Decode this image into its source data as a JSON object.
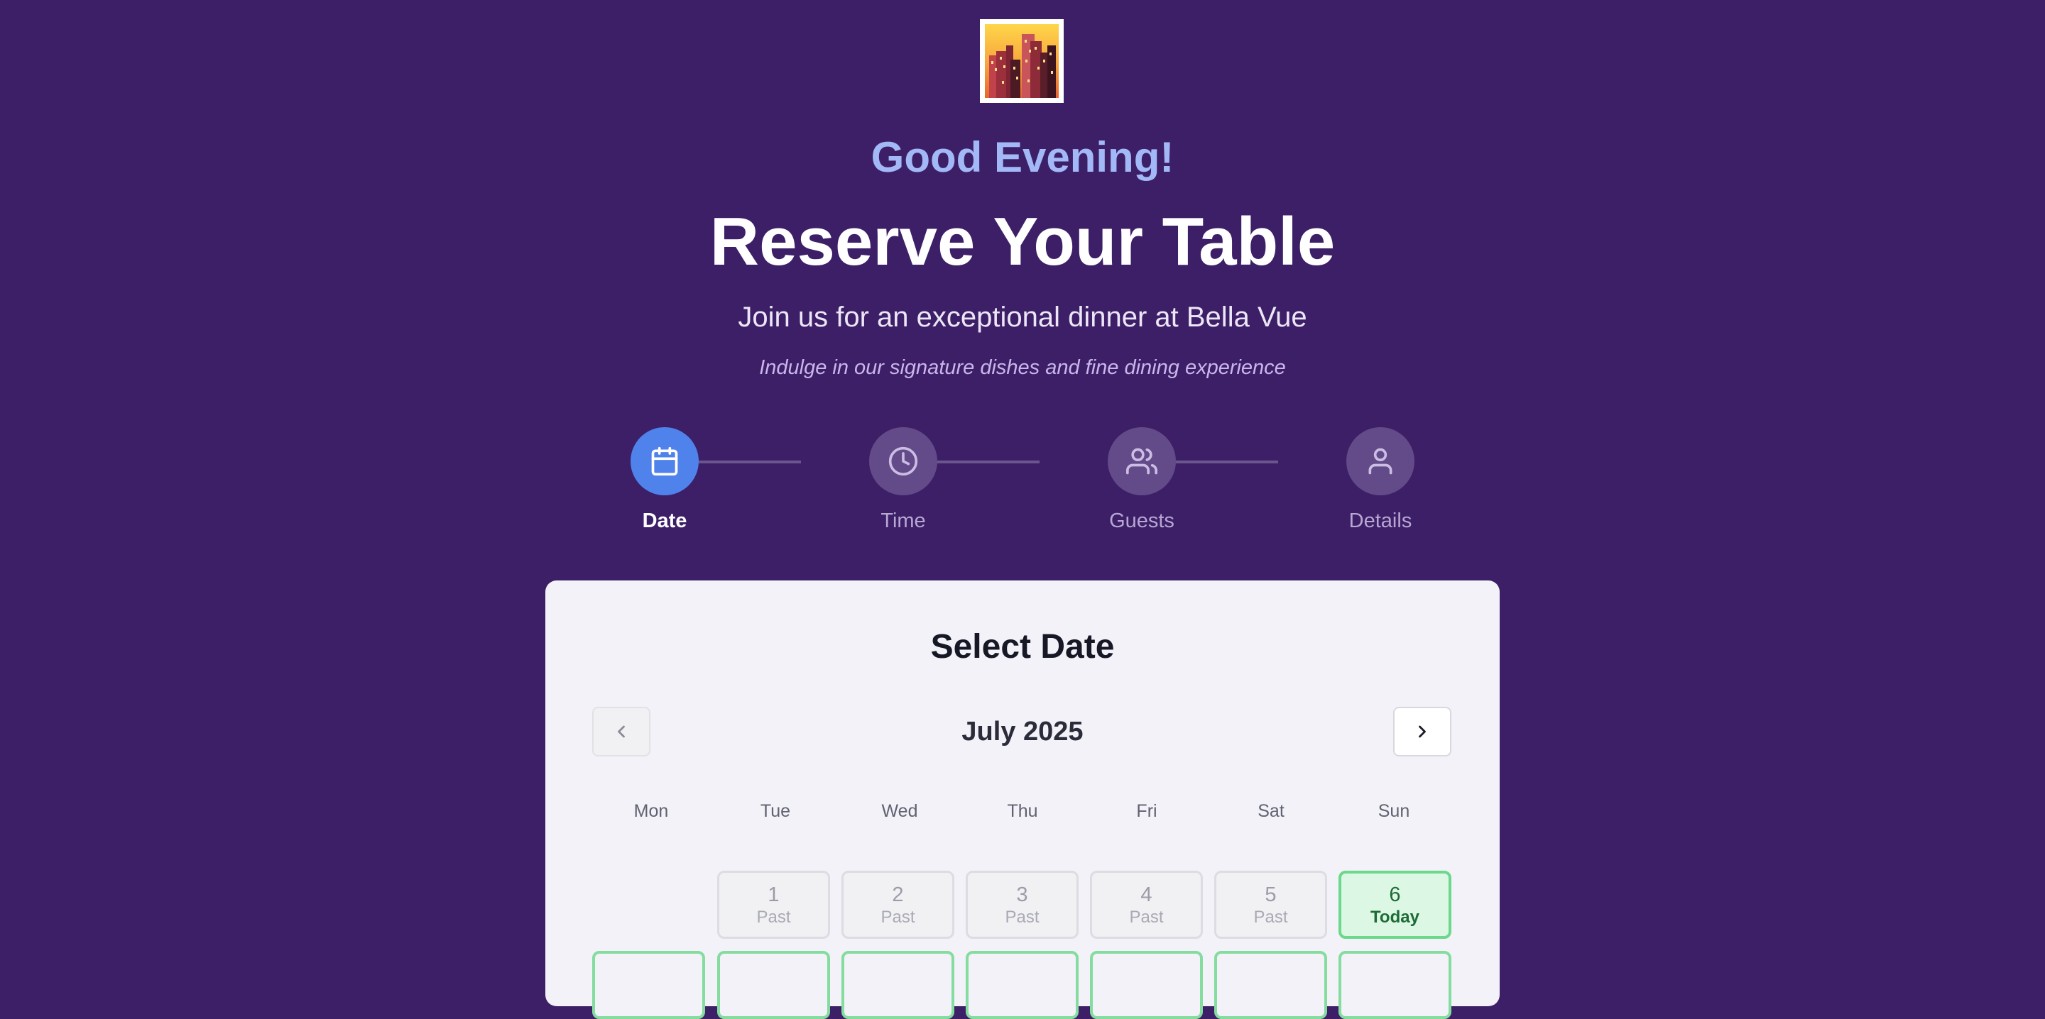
{
  "logo": {
    "icon": "cityscape-sunset-icon"
  },
  "header": {
    "greeting": "Good Evening!",
    "title": "Reserve Your Table",
    "subtitle": "Join us for an exceptional dinner at Bella Vue",
    "tagline": "Indulge in our signature dishes and fine dining experience"
  },
  "steps": [
    {
      "label": "Date",
      "icon": "calendar-icon",
      "state": "active"
    },
    {
      "label": "Time",
      "icon": "clock-icon",
      "state": "pending"
    },
    {
      "label": "Guests",
      "icon": "users-icon",
      "state": "pending"
    },
    {
      "label": "Details",
      "icon": "user-icon",
      "state": "pending"
    }
  ],
  "calendar": {
    "heading": "Select Date",
    "month_label": "July 2025",
    "prev_icon": "chevron-left-icon",
    "next_icon": "chevron-right-icon",
    "weekdays": [
      "Mon",
      "Tue",
      "Wed",
      "Thu",
      "Fri",
      "Sat",
      "Sun"
    ],
    "days": [
      {
        "day": "1",
        "note": "Past",
        "state": "past"
      },
      {
        "day": "2",
        "note": "Past",
        "state": "past"
      },
      {
        "day": "3",
        "note": "Past",
        "state": "past"
      },
      {
        "day": "4",
        "note": "Past",
        "state": "past"
      },
      {
        "day": "5",
        "note": "Past",
        "state": "past"
      },
      {
        "day": "6",
        "note": "Today",
        "state": "today"
      }
    ]
  },
  "colors": {
    "background": "#3d1f68",
    "greeting": "#a3b8f6",
    "active_step": "#4f82ea",
    "today_border": "#6cd88c"
  }
}
